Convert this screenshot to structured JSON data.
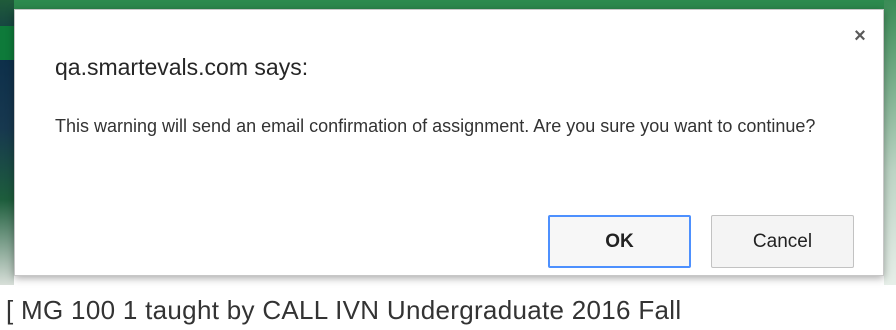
{
  "background": {
    "partial_text": "[ MG 100 1 taught by CALL IVN Undergraduate 2016 Fall"
  },
  "dialog": {
    "title": "qa.smartevals.com says:",
    "message": "This warning will send an email confirmation of assignment. Are you sure you want to continue?",
    "close_glyph": "×",
    "buttons": {
      "ok_label": "OK",
      "cancel_label": "Cancel"
    }
  },
  "colors": {
    "accent_focus": "#4d90fe",
    "bg_green": "#2d8a4e"
  }
}
